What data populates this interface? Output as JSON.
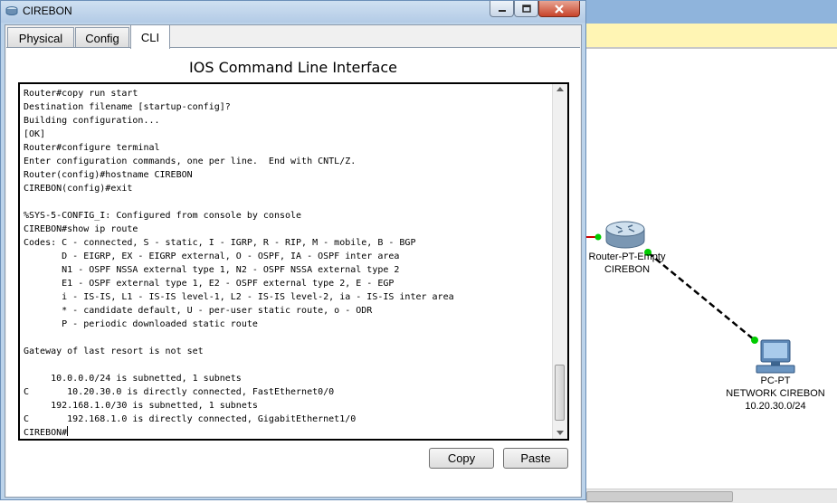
{
  "window": {
    "title": "CIREBON",
    "tabs": [
      {
        "label": "Physical",
        "active": false
      },
      {
        "label": "Config",
        "active": false
      },
      {
        "label": "CLI",
        "active": true
      }
    ],
    "panel_heading": "IOS Command Line Interface",
    "buttons": {
      "copy": "Copy",
      "paste": "Paste"
    }
  },
  "terminal": {
    "lines": [
      "Router#copy run start",
      "Destination filename [startup-config]?",
      "Building configuration...",
      "[OK]",
      "Router#configure terminal",
      "Enter configuration commands, one per line.  End with CNTL/Z.",
      "Router(config)#hostname CIREBON",
      "CIREBON(config)#exit",
      "",
      "%SYS-5-CONFIG_I: Configured from console by console",
      "CIREBON#show ip route",
      "Codes: C - connected, S - static, I - IGRP, R - RIP, M - mobile, B - BGP",
      "       D - EIGRP, EX - EIGRP external, O - OSPF, IA - OSPF inter area",
      "       N1 - OSPF NSSA external type 1, N2 - OSPF NSSA external type 2",
      "       E1 - OSPF external type 1, E2 - OSPF external type 2, E - EGP",
      "       i - IS-IS, L1 - IS-IS level-1, L2 - IS-IS level-2, ia - IS-IS inter area",
      "       * - candidate default, U - per-user static route, o - ODR",
      "       P - periodic downloaded static route",
      "",
      "Gateway of last resort is not set",
      "",
      "     10.0.0.0/24 is subnetted, 1 subnets",
      "C       10.20.30.0 is directly connected, FastEthernet0/0",
      "     192.168.1.0/30 is subnetted, 1 subnets",
      "C       192.168.1.0 is directly connected, GigabitEthernet1/0"
    ],
    "prompt": "CIREBON#"
  },
  "topology": {
    "router": {
      "model": "Router-PT-Empty",
      "name": "CIREBON",
      "icon": "router-icon"
    },
    "pc": {
      "model": "PC-PT",
      "name": "NETWORK CIREBON",
      "network": "10.20.30.0/24",
      "icon": "pc-icon"
    },
    "link_status_color": "#00cc00",
    "other_link_color": "#cc0000"
  }
}
